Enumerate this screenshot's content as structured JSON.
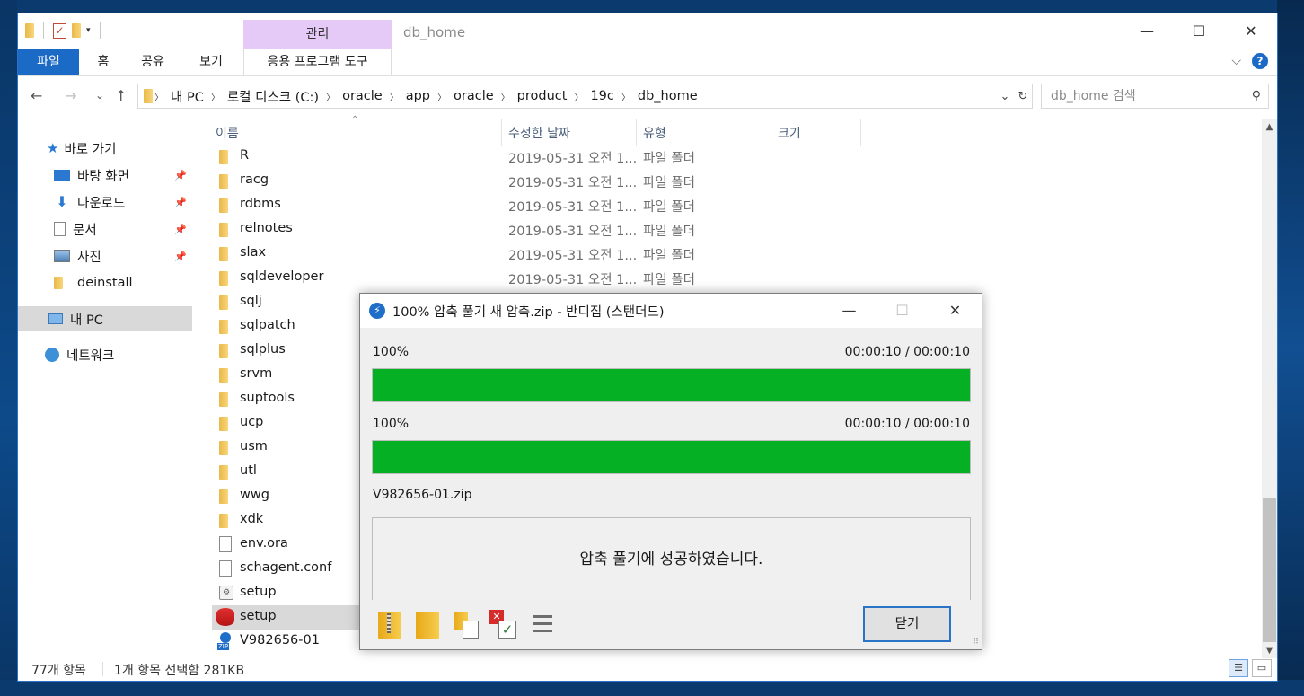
{
  "window": {
    "title": "db_home",
    "manage_tab": "관리",
    "min": "—",
    "max": "☐",
    "close": "✕"
  },
  "ribbon": {
    "tabs": [
      "파일",
      "홈",
      "공유",
      "보기",
      "응용 프로그램 도구"
    ]
  },
  "nav": {
    "back": "←",
    "forward": "→",
    "recent": "⌄",
    "up": "↑",
    "breadcrumb": [
      "내 PC",
      "로컬 디스크 (C:)",
      "oracle",
      "app",
      "oracle",
      "product",
      "19c",
      "db_home"
    ],
    "refresh": "↻",
    "search_placeholder": "db_home 검색"
  },
  "sidebar": {
    "items": [
      {
        "label": "바로 가기",
        "icon": "star-icon"
      },
      {
        "label": "바탕 화면",
        "icon": "desktop-icon",
        "pinned": true
      },
      {
        "label": "다운로드",
        "icon": "download-icon",
        "pinned": true
      },
      {
        "label": "문서",
        "icon": "document-icon",
        "pinned": true
      },
      {
        "label": "사진",
        "icon": "picture-icon",
        "pinned": true
      },
      {
        "label": "deinstall",
        "icon": "folder-icon"
      },
      {
        "label": "내 PC",
        "icon": "pc-icon",
        "selected": true
      },
      {
        "label": "네트워크",
        "icon": "network-icon"
      }
    ]
  },
  "columns": {
    "name": "이름",
    "date": "수정한 날짜",
    "type": "유형",
    "size": "크기"
  },
  "files": [
    {
      "name": "R",
      "date": "2019-05-31 오전 1...",
      "type": "파일 폴더",
      "icon": "folder-icon"
    },
    {
      "name": "racg",
      "date": "2019-05-31 오전 1...",
      "type": "파일 폴더",
      "icon": "folder-icon"
    },
    {
      "name": "rdbms",
      "date": "2019-05-31 오전 1...",
      "type": "파일 폴더",
      "icon": "folder-icon"
    },
    {
      "name": "relnotes",
      "date": "2019-05-31 오전 1...",
      "type": "파일 폴더",
      "icon": "folder-icon"
    },
    {
      "name": "slax",
      "date": "2019-05-31 오전 1...",
      "type": "파일 폴더",
      "icon": "folder-icon"
    },
    {
      "name": "sqldeveloper",
      "date": "2019-05-31 오전 1...",
      "type": "파일 폴더",
      "icon": "folder-icon"
    },
    {
      "name": "sqlj",
      "date": "",
      "type": "",
      "icon": "folder-icon"
    },
    {
      "name": "sqlpatch",
      "date": "",
      "type": "",
      "icon": "folder-icon"
    },
    {
      "name": "sqlplus",
      "date": "",
      "type": "",
      "icon": "folder-icon"
    },
    {
      "name": "srvm",
      "date": "",
      "type": "",
      "icon": "folder-icon"
    },
    {
      "name": "suptools",
      "date": "",
      "type": "",
      "icon": "folder-icon"
    },
    {
      "name": "ucp",
      "date": "",
      "type": "",
      "icon": "folder-icon"
    },
    {
      "name": "usm",
      "date": "",
      "type": "",
      "icon": "folder-icon"
    },
    {
      "name": "utl",
      "date": "",
      "type": "",
      "icon": "folder-icon"
    },
    {
      "name": "wwg",
      "date": "",
      "type": "",
      "icon": "folder-icon"
    },
    {
      "name": "xdk",
      "date": "",
      "type": "",
      "icon": "folder-icon"
    },
    {
      "name": "env.ora",
      "date": "",
      "type": "",
      "icon": "file-icon"
    },
    {
      "name": "schagent.conf",
      "date": "",
      "type": "",
      "icon": "file-icon"
    },
    {
      "name": "setup",
      "date": "",
      "type": "",
      "icon": "setup-script-icon"
    },
    {
      "name": "setup",
      "date": "",
      "type": "",
      "icon": "database-setup-icon",
      "selected": true
    },
    {
      "name": "V982656-01",
      "date": "",
      "type": "",
      "icon": "zip-icon"
    }
  ],
  "status": {
    "count": "77개 항목",
    "selection": "1개 항목 선택함 281KB"
  },
  "dialog": {
    "title": "100% 압축 풀기 새 압축.zip - 반디집 (스탠더드)",
    "progress1": {
      "percent_label": "100%",
      "time": "00:00:10 / 00:00:10",
      "value": 100
    },
    "progress2": {
      "percent_label": "100%",
      "time": "00:00:10 / 00:00:10",
      "value": 100
    },
    "filename": "V982656-01.zip",
    "message": "압축 풀기에 성공하였습니다.",
    "close_button": "닫기"
  },
  "colors": {
    "accent": "#1b6ac6",
    "progress": "#06b025",
    "manage_tab": "#e5c9f7"
  }
}
